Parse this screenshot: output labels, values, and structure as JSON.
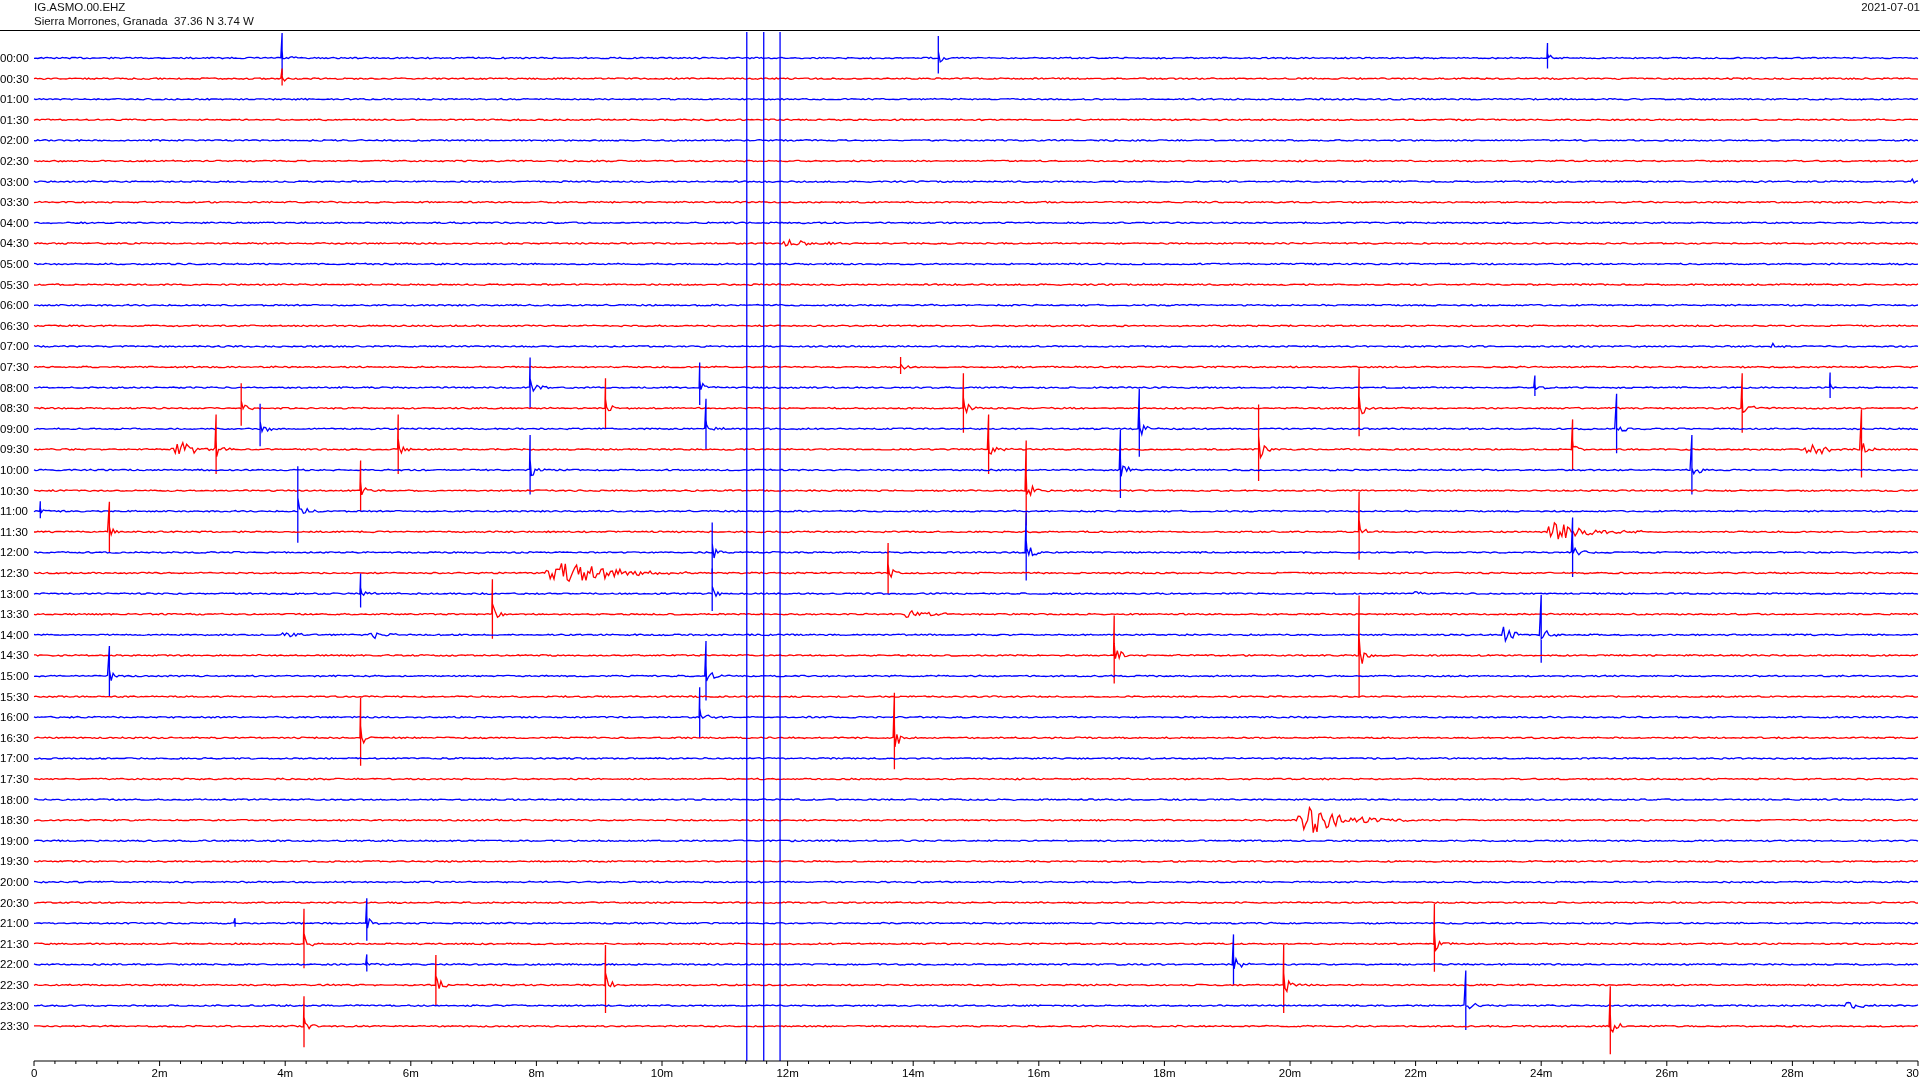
{
  "header": {
    "station": "IG.ASMO.00.EHZ",
    "location": "Sierra Morrones, Granada  37.36 N 3.74 W",
    "date": "2021-07-01"
  },
  "rows": [
    {
      "time": "00:00",
      "color": "#0000ff"
    },
    {
      "time": "00:30",
      "color": "#ff0000"
    },
    {
      "time": "01:00",
      "color": "#0000ff"
    },
    {
      "time": "01:30",
      "color": "#ff0000"
    },
    {
      "time": "02:00",
      "color": "#0000ff"
    },
    {
      "time": "02:30",
      "color": "#ff0000"
    },
    {
      "time": "03:00",
      "color": "#0000ff"
    },
    {
      "time": "03:30",
      "color": "#ff0000"
    },
    {
      "time": "04:00",
      "color": "#0000ff"
    },
    {
      "time": "04:30",
      "color": "#ff0000"
    },
    {
      "time": "05:00",
      "color": "#0000ff"
    },
    {
      "time": "05:30",
      "color": "#ff0000"
    },
    {
      "time": "06:00",
      "color": "#0000ff"
    },
    {
      "time": "06:30",
      "color": "#ff0000"
    },
    {
      "time": "07:00",
      "color": "#0000ff"
    },
    {
      "time": "07:30",
      "color": "#ff0000"
    },
    {
      "time": "08:00",
      "color": "#0000ff"
    },
    {
      "time": "08:30",
      "color": "#ff0000"
    },
    {
      "time": "09:00",
      "color": "#0000ff"
    },
    {
      "time": "09:30",
      "color": "#ff0000"
    },
    {
      "time": "10:00",
      "color": "#0000ff"
    },
    {
      "time": "10:30",
      "color": "#ff0000"
    },
    {
      "time": "11:00",
      "color": "#0000ff"
    },
    {
      "time": "11:30",
      "color": "#ff0000"
    },
    {
      "time": "12:00",
      "color": "#0000ff"
    },
    {
      "time": "12:30",
      "color": "#ff0000"
    },
    {
      "time": "13:00",
      "color": "#0000ff"
    },
    {
      "time": "13:30",
      "color": "#ff0000"
    },
    {
      "time": "14:00",
      "color": "#0000ff"
    },
    {
      "time": "14:30",
      "color": "#ff0000"
    },
    {
      "time": "15:00",
      "color": "#0000ff"
    },
    {
      "time": "15:30",
      "color": "#ff0000"
    },
    {
      "time": "16:00",
      "color": "#0000ff"
    },
    {
      "time": "16:30",
      "color": "#ff0000"
    },
    {
      "time": "17:00",
      "color": "#0000ff"
    },
    {
      "time": "17:30",
      "color": "#ff0000"
    },
    {
      "time": "18:00",
      "color": "#0000ff"
    },
    {
      "time": "18:30",
      "color": "#ff0000"
    },
    {
      "time": "19:00",
      "color": "#0000ff"
    },
    {
      "time": "19:30",
      "color": "#ff0000"
    },
    {
      "time": "20:00",
      "color": "#0000ff"
    },
    {
      "time": "20:30",
      "color": "#ff0000"
    },
    {
      "time": "21:00",
      "color": "#0000ff"
    },
    {
      "time": "21:30",
      "color": "#ff0000"
    },
    {
      "time": "22:00",
      "color": "#0000ff"
    },
    {
      "time": "22:30",
      "color": "#ff0000"
    },
    {
      "time": "23:00",
      "color": "#0000ff"
    },
    {
      "time": "23:30",
      "color": "#ff0000"
    }
  ],
  "axis": {
    "labels": [
      "0",
      "2m",
      "4m",
      "6m",
      "8m",
      "10m",
      "12m",
      "14m",
      "16m",
      "18m",
      "20m",
      "22m",
      "24m",
      "26m",
      "28m",
      "30"
    ]
  }
}
